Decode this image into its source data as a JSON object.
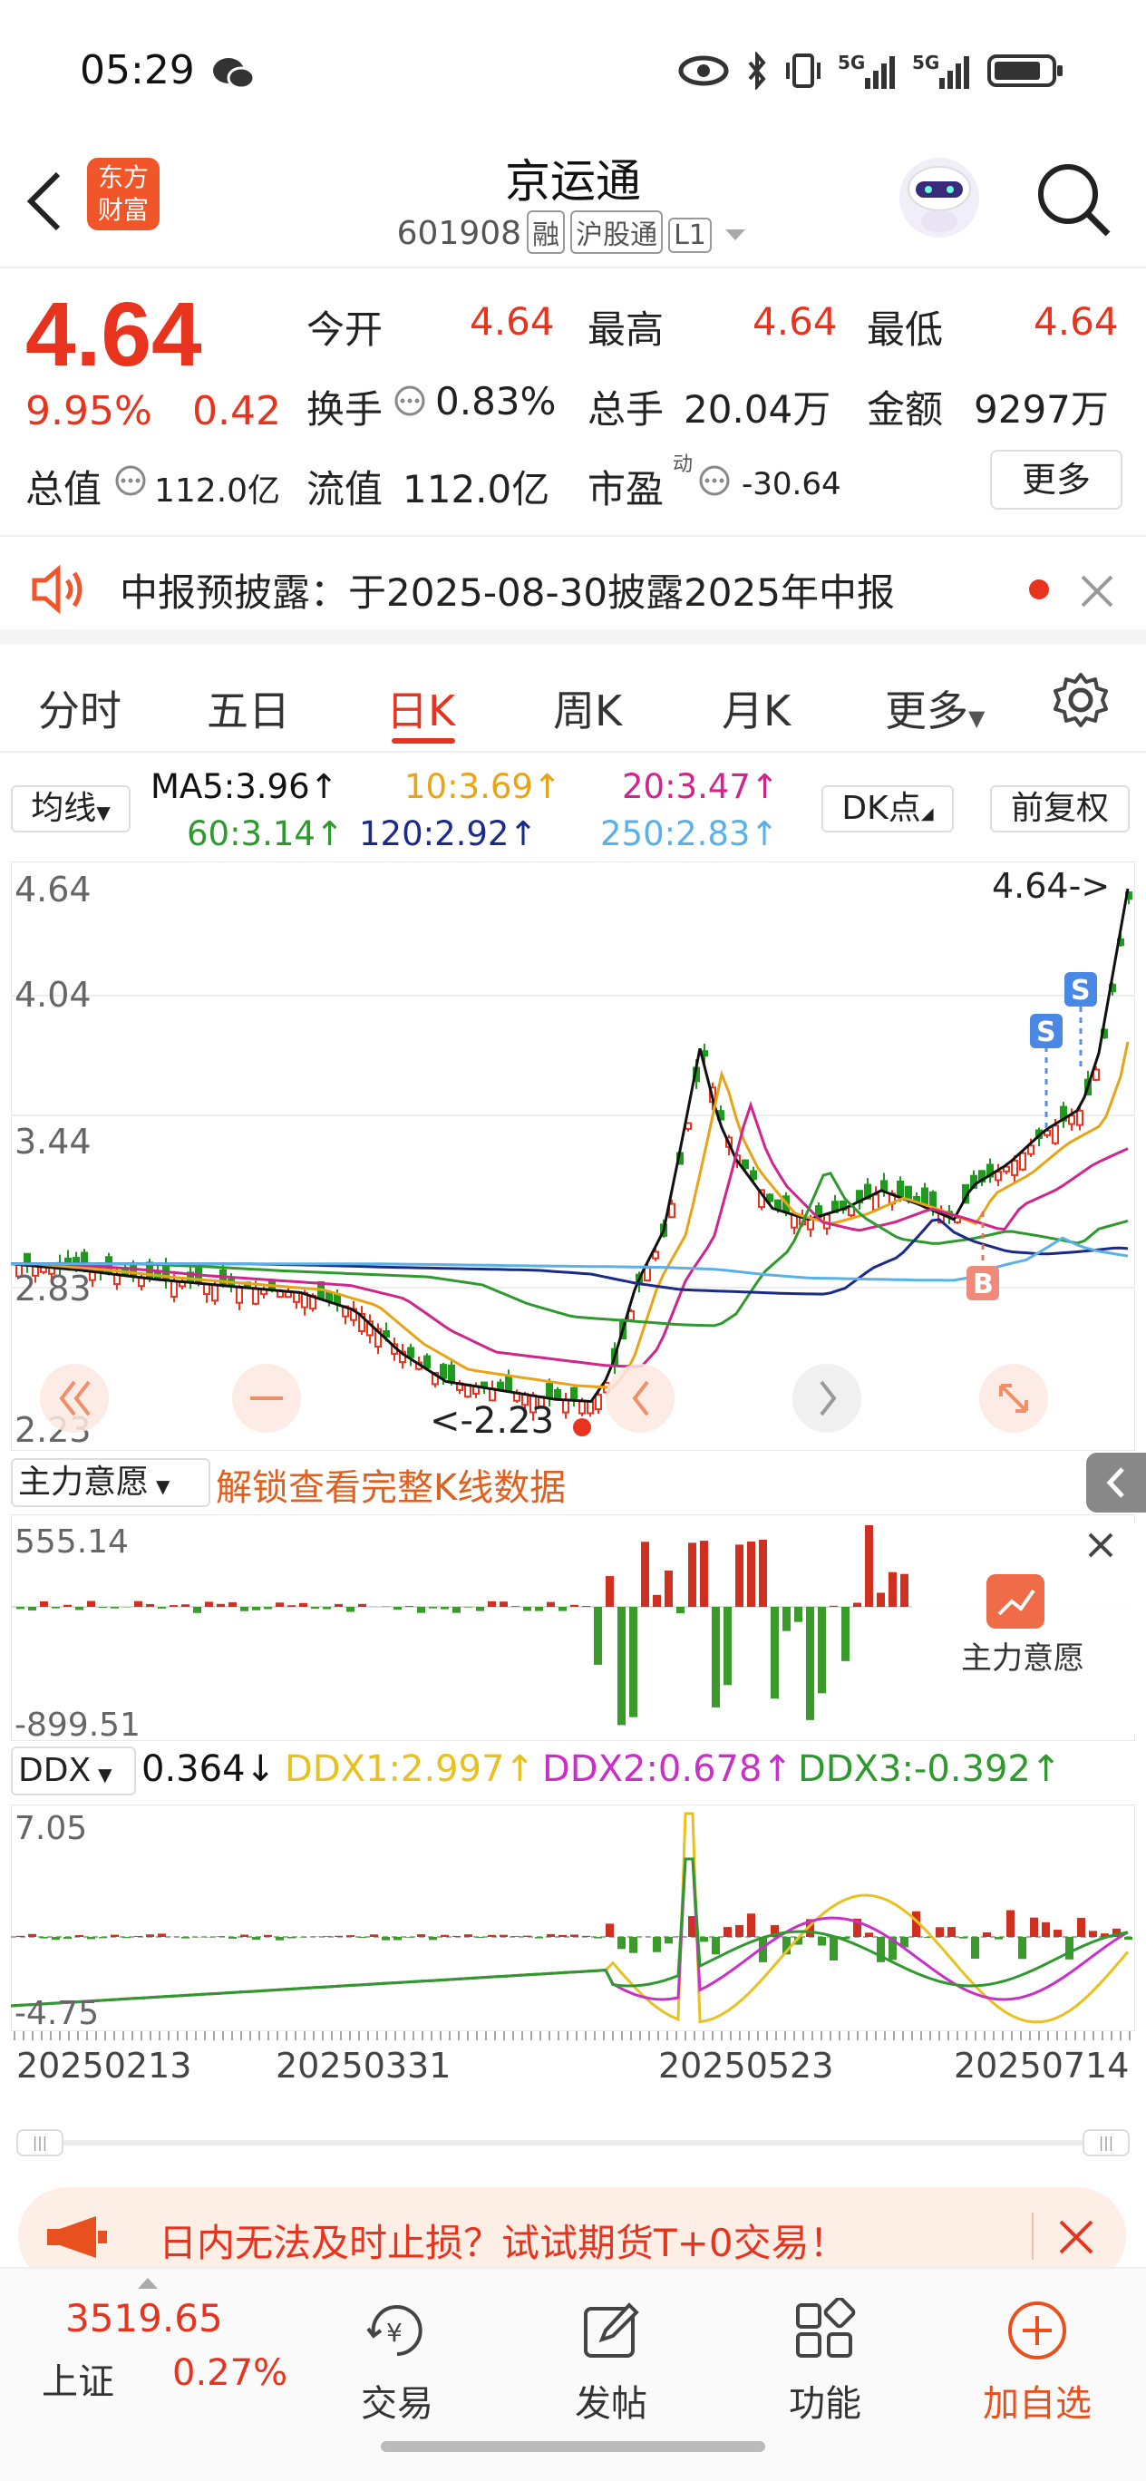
{
  "status_bar": {
    "time": "05:29"
  },
  "header": {
    "back_label": "<",
    "logo_line1": "东方",
    "logo_line2": "财富",
    "stock_name": "京运通",
    "stock_code": "601908",
    "tags": [
      "融",
      "沪股通",
      "L1"
    ]
  },
  "quote": {
    "price": "4.64",
    "change_pct": "9.95%",
    "change_amt": "0.42",
    "fields": [
      {
        "label": "今开",
        "value": "4.64",
        "color": "red"
      },
      {
        "label": "最高",
        "value": "4.64",
        "color": "red"
      },
      {
        "label": "最低",
        "value": "4.64",
        "color": "red"
      },
      {
        "label": "换手",
        "value": "0.83%",
        "color": "black"
      },
      {
        "label": "总手",
        "value": "20.04万",
        "color": "black"
      },
      {
        "label": "金额",
        "value": "9297万",
        "color": "black"
      },
      {
        "label": "总值",
        "value": "112.0亿",
        "color": "black"
      },
      {
        "label": "流值",
        "value": "112.0亿",
        "color": "black"
      },
      {
        "label": "市盈",
        "value": "-30.64",
        "color": "black"
      }
    ],
    "pe_superscript": "动",
    "more_label": "更多"
  },
  "notice": {
    "text": "中报预披露：于2025-08-30披露2025年中报"
  },
  "tabs": [
    "分时",
    "五日",
    "日K",
    "周K",
    "月K",
    "更多"
  ],
  "active_tab": "日K",
  "ma_row": {
    "selector": "均线",
    "ma5": "MA5:3.96",
    "ma10": "10:3.69",
    "ma20": "20:3.47",
    "ma60": "60:3.14",
    "ma120": "120:2.92",
    "ma250": "250:2.83",
    "dk_label": "DK点",
    "adjust_label": "前复权",
    "colors": {
      "ma5": "#111111",
      "ma10": "#e8a317",
      "ma20": "#d0258c",
      "ma60": "#2e9a2e",
      "ma120": "#1a2a8a",
      "ma250": "#5ab0e8"
    }
  },
  "kline": {
    "y_ticks": [
      "4.64",
      "4.04",
      "3.44",
      "2.83",
      "2.23"
    ],
    "last_price_label": "4.64->",
    "min_label": "<-2.23",
    "s_label": "S",
    "b_label": "B"
  },
  "main_force": {
    "selector": "主力意愿",
    "unlock_text": "解锁查看完整K线数据",
    "max_label": "555.14",
    "min_label": "-899.51",
    "overlay_label": "主力意愿"
  },
  "ddx": {
    "selector": "DDX",
    "ddx": "0.364",
    "ddx1": "DDX1:2.997",
    "ddx2": "DDX2:0.678",
    "ddx3": "DDX3:-0.392",
    "max_label": "7.05",
    "min_label": "-4.75"
  },
  "dates": [
    "20250213",
    "20250331",
    "20250523",
    "20250714"
  ],
  "ad": {
    "text": "日内无法及时止损？试试期货T+0交易！"
  },
  "bottom_nav": {
    "index_value": "3519.65",
    "index_name": "上证",
    "index_change": "0.27%",
    "items": [
      "交易",
      "发帖",
      "功能",
      "加自选"
    ]
  }
}
